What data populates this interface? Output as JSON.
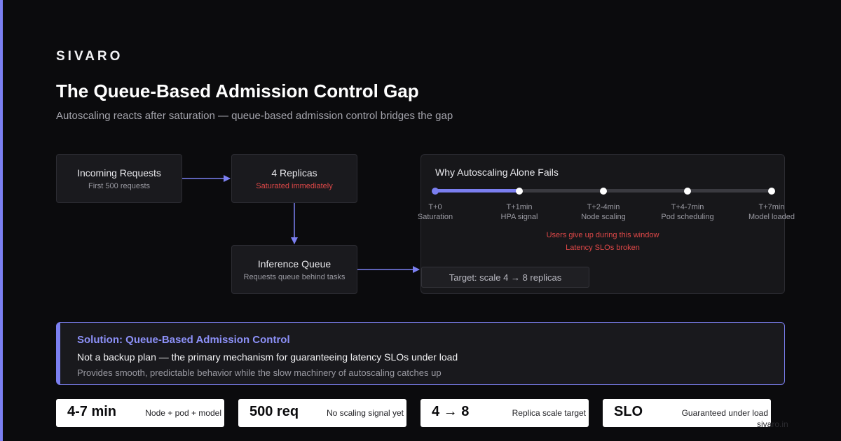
{
  "brand": "SIVARO",
  "title": "The Queue-Based Admission Control Gap",
  "subtitle": "Autoscaling reacts after saturation — queue-based admission control bridges the gap",
  "flow": {
    "incoming": {
      "label": "Incoming Requests",
      "sub": "First 500 requests"
    },
    "replicas": {
      "label": "4 Replicas",
      "sub": "Saturated immediately"
    },
    "queue": {
      "label": "Inference Queue",
      "sub": "Requests queue behind tasks"
    }
  },
  "timeline": {
    "title": "Why Autoscaling Alone Fails",
    "progress": 0.25,
    "points": [
      {
        "time": "T+0",
        "label": "Saturation"
      },
      {
        "time": "T+1min",
        "label": "HPA signal"
      },
      {
        "time": "T+2-4min",
        "label": "Node scaling"
      },
      {
        "time": "T+4-7min",
        "label": "Pod scheduling"
      },
      {
        "time": "T+7min",
        "label": "Model loaded"
      }
    ],
    "warning1": "Users give up during this window",
    "warning2": "Latency SLOs broken",
    "target": "Target: scale 4 → 8 replicas"
  },
  "solution": {
    "title": "Solution: Queue-Based Admission Control",
    "line1": "Not a backup plan — the primary mechanism for guaranteeing latency SLOs under load",
    "line2": "Provides smooth, predictable behavior while the slow machinery of autoscaling catches up"
  },
  "stats": [
    {
      "value": "4-7 min",
      "label": "Node + pod + model"
    },
    {
      "value": "500 req",
      "label": "No scaling signal yet"
    },
    {
      "value": "4 → 8",
      "label": "Replica scale target"
    },
    {
      "value": "SLO",
      "label": "Guaranteed under load"
    }
  ],
  "footer": "sivaro.in",
  "colors": {
    "accent": "#7b7ff0",
    "warning": "#e04848",
    "background": "#0b0b0d"
  }
}
